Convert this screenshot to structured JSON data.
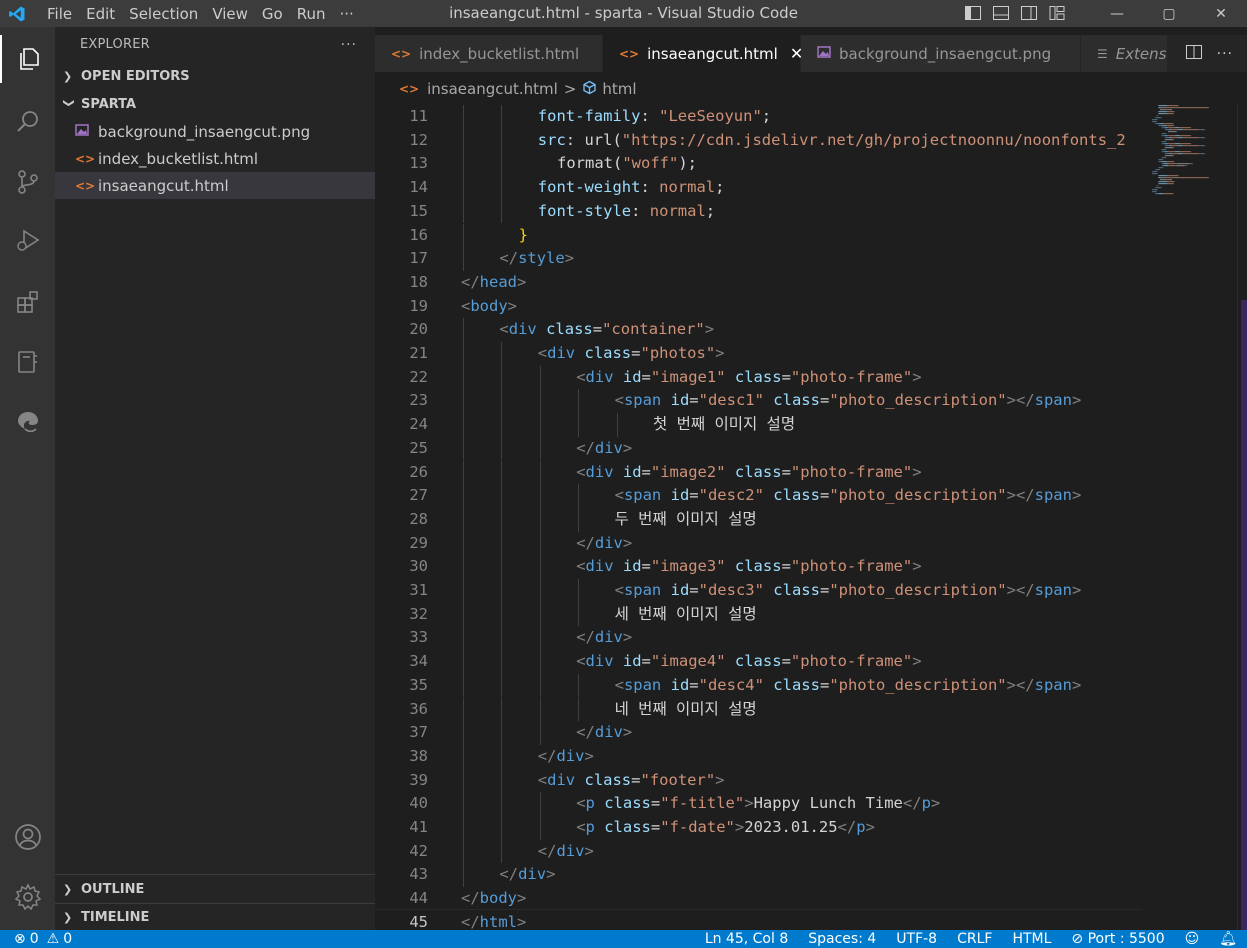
{
  "window": {
    "title": "insaeangcut.html - sparta - Visual Studio Code",
    "menu": [
      "File",
      "Edit",
      "Selection",
      "View",
      "Go",
      "Run",
      "···"
    ]
  },
  "activity_bar": {
    "items": [
      "explorer-icon",
      "search-icon",
      "source-control-icon",
      "run-debug-icon",
      "extensions-icon",
      "remote-explorer-icon",
      "edge-devtools-icon"
    ],
    "bottom": [
      "account-icon",
      "manage-gear-icon"
    ]
  },
  "sidebar": {
    "title": "EXPLORER",
    "more": "···",
    "open_editors": "OPEN EDITORS",
    "folder": "SPARTA",
    "files": [
      {
        "name": "background_insaengcut.png",
        "type": "image"
      },
      {
        "name": "index_bucketlist.html",
        "type": "html"
      },
      {
        "name": "insaeangcut.html",
        "type": "html",
        "selected": true
      }
    ],
    "outline": "OUTLINE",
    "timeline": "TIMELINE"
  },
  "tabs": [
    {
      "label": "index_bucketlist.html",
      "type": "html",
      "active": false
    },
    {
      "label": "insaeangcut.html",
      "type": "html",
      "active": true
    },
    {
      "label": "background_insaengcut.png",
      "type": "image",
      "active": false
    },
    {
      "label": "Extens",
      "type": "extension",
      "active": false
    }
  ],
  "breadcrumb": {
    "file": "insaeangcut.html",
    "separator": ">",
    "symbol": "html"
  },
  "editor": {
    "lines": [
      {
        "n": 11,
        "indent": 8,
        "tokens": [
          [
            "attr",
            "font-family"
          ],
          [
            "txt",
            ": "
          ],
          [
            "str",
            "\"LeeSeoyun\""
          ],
          [
            "txt",
            ";"
          ]
        ]
      },
      {
        "n": 12,
        "indent": 8,
        "tokens": [
          [
            "attr",
            "src"
          ],
          [
            "txt",
            ": "
          ],
          [
            "txt",
            "url("
          ],
          [
            "str",
            "\"https://cdn.jsdelivr.net/gh/projectnoonnu/noonfonts_2"
          ]
        ]
      },
      {
        "n": 13,
        "indent": 10,
        "tokens": [
          [
            "txt",
            "format("
          ],
          [
            "str",
            "\"woff\""
          ],
          [
            "txt",
            ");"
          ]
        ]
      },
      {
        "n": 14,
        "indent": 8,
        "tokens": [
          [
            "attr",
            "font-weight"
          ],
          [
            "txt",
            ": "
          ],
          [
            "str",
            "normal"
          ],
          [
            "txt",
            ";"
          ]
        ]
      },
      {
        "n": 15,
        "indent": 8,
        "tokens": [
          [
            "attr",
            "font-style"
          ],
          [
            "txt",
            ": "
          ],
          [
            "str",
            "normal"
          ],
          [
            "txt",
            ";"
          ]
        ]
      },
      {
        "n": 16,
        "indent": 6,
        "tokens": [
          [
            "brace",
            "}"
          ]
        ]
      },
      {
        "n": 17,
        "indent": 4,
        "tokens": [
          [
            "punct",
            "</"
          ],
          [
            "tag",
            "style"
          ],
          [
            "punct",
            ">"
          ]
        ]
      },
      {
        "n": 18,
        "indent": 0,
        "tokens": [
          [
            "punct",
            "</"
          ],
          [
            "tag",
            "head"
          ],
          [
            "punct",
            ">"
          ]
        ]
      },
      {
        "n": 19,
        "indent": 0,
        "tokens": [
          [
            "punct",
            "<"
          ],
          [
            "tag",
            "body"
          ],
          [
            "punct",
            ">"
          ]
        ]
      },
      {
        "n": 20,
        "indent": 4,
        "tokens": [
          [
            "punct",
            "<"
          ],
          [
            "tag",
            "div"
          ],
          [
            "txt",
            " "
          ],
          [
            "attr",
            "class"
          ],
          [
            "txt",
            "="
          ],
          [
            "str",
            "\"container\""
          ],
          [
            "punct",
            ">"
          ]
        ]
      },
      {
        "n": 21,
        "indent": 8,
        "tokens": [
          [
            "punct",
            "<"
          ],
          [
            "tag",
            "div"
          ],
          [
            "txt",
            " "
          ],
          [
            "attr",
            "class"
          ],
          [
            "txt",
            "="
          ],
          [
            "str",
            "\"photos\""
          ],
          [
            "punct",
            ">"
          ]
        ]
      },
      {
        "n": 22,
        "indent": 12,
        "tokens": [
          [
            "punct",
            "<"
          ],
          [
            "tag",
            "div"
          ],
          [
            "txt",
            " "
          ],
          [
            "attr",
            "id"
          ],
          [
            "txt",
            "="
          ],
          [
            "str",
            "\"image1\""
          ],
          [
            "txt",
            " "
          ],
          [
            "attr",
            "class"
          ],
          [
            "txt",
            "="
          ],
          [
            "str",
            "\"photo-frame\""
          ],
          [
            "punct",
            ">"
          ]
        ]
      },
      {
        "n": 23,
        "indent": 16,
        "tokens": [
          [
            "punct",
            "<"
          ],
          [
            "tag",
            "span"
          ],
          [
            "txt",
            " "
          ],
          [
            "attr",
            "id"
          ],
          [
            "txt",
            "="
          ],
          [
            "str",
            "\"desc1\""
          ],
          [
            "txt",
            " "
          ],
          [
            "attr",
            "class"
          ],
          [
            "txt",
            "="
          ],
          [
            "str",
            "\"photo_description\""
          ],
          [
            "punct",
            "></"
          ],
          [
            "tag",
            "span"
          ],
          [
            "punct",
            ">"
          ]
        ]
      },
      {
        "n": 24,
        "indent": 20,
        "tokens": [
          [
            "txt",
            "첫 번째 이미지 설명"
          ]
        ]
      },
      {
        "n": 25,
        "indent": 12,
        "tokens": [
          [
            "punct",
            "</"
          ],
          [
            "tag",
            "div"
          ],
          [
            "punct",
            ">"
          ]
        ]
      },
      {
        "n": 26,
        "indent": 12,
        "tokens": [
          [
            "punct",
            "<"
          ],
          [
            "tag",
            "div"
          ],
          [
            "txt",
            " "
          ],
          [
            "attr",
            "id"
          ],
          [
            "txt",
            "="
          ],
          [
            "str",
            "\"image2\""
          ],
          [
            "txt",
            " "
          ],
          [
            "attr",
            "class"
          ],
          [
            "txt",
            "="
          ],
          [
            "str",
            "\"photo-frame\""
          ],
          [
            "punct",
            ">"
          ]
        ]
      },
      {
        "n": 27,
        "indent": 16,
        "tokens": [
          [
            "punct",
            "<"
          ],
          [
            "tag",
            "span"
          ],
          [
            "txt",
            " "
          ],
          [
            "attr",
            "id"
          ],
          [
            "txt",
            "="
          ],
          [
            "str",
            "\"desc2\""
          ],
          [
            "txt",
            " "
          ],
          [
            "attr",
            "class"
          ],
          [
            "txt",
            "="
          ],
          [
            "str",
            "\"photo_description\""
          ],
          [
            "punct",
            "></"
          ],
          [
            "tag",
            "span"
          ],
          [
            "punct",
            ">"
          ]
        ]
      },
      {
        "n": 28,
        "indent": 16,
        "tokens": [
          [
            "txt",
            "두 번째 이미지 설명"
          ]
        ]
      },
      {
        "n": 29,
        "indent": 12,
        "tokens": [
          [
            "punct",
            "</"
          ],
          [
            "tag",
            "div"
          ],
          [
            "punct",
            ">"
          ]
        ]
      },
      {
        "n": 30,
        "indent": 12,
        "tokens": [
          [
            "punct",
            "<"
          ],
          [
            "tag",
            "div"
          ],
          [
            "txt",
            " "
          ],
          [
            "attr",
            "id"
          ],
          [
            "txt",
            "="
          ],
          [
            "str",
            "\"image3\""
          ],
          [
            "txt",
            " "
          ],
          [
            "attr",
            "class"
          ],
          [
            "txt",
            "="
          ],
          [
            "str",
            "\"photo-frame\""
          ],
          [
            "punct",
            ">"
          ]
        ]
      },
      {
        "n": 31,
        "indent": 16,
        "tokens": [
          [
            "punct",
            "<"
          ],
          [
            "tag",
            "span"
          ],
          [
            "txt",
            " "
          ],
          [
            "attr",
            "id"
          ],
          [
            "txt",
            "="
          ],
          [
            "str",
            "\"desc3\""
          ],
          [
            "txt",
            " "
          ],
          [
            "attr",
            "class"
          ],
          [
            "txt",
            "="
          ],
          [
            "str",
            "\"photo_description\""
          ],
          [
            "punct",
            "></"
          ],
          [
            "tag",
            "span"
          ],
          [
            "punct",
            ">"
          ]
        ]
      },
      {
        "n": 32,
        "indent": 16,
        "tokens": [
          [
            "txt",
            "세 번째 이미지 설명"
          ]
        ]
      },
      {
        "n": 33,
        "indent": 12,
        "tokens": [
          [
            "punct",
            "</"
          ],
          [
            "tag",
            "div"
          ],
          [
            "punct",
            ">"
          ]
        ]
      },
      {
        "n": 34,
        "indent": 12,
        "tokens": [
          [
            "punct",
            "<"
          ],
          [
            "tag",
            "div"
          ],
          [
            "txt",
            " "
          ],
          [
            "attr",
            "id"
          ],
          [
            "txt",
            "="
          ],
          [
            "str",
            "\"image4\""
          ],
          [
            "txt",
            " "
          ],
          [
            "attr",
            "class"
          ],
          [
            "txt",
            "="
          ],
          [
            "str",
            "\"photo-frame\""
          ],
          [
            "punct",
            ">"
          ]
        ]
      },
      {
        "n": 35,
        "indent": 16,
        "tokens": [
          [
            "punct",
            "<"
          ],
          [
            "tag",
            "span"
          ],
          [
            "txt",
            " "
          ],
          [
            "attr",
            "id"
          ],
          [
            "txt",
            "="
          ],
          [
            "str",
            "\"desc4\""
          ],
          [
            "txt",
            " "
          ],
          [
            "attr",
            "class"
          ],
          [
            "txt",
            "="
          ],
          [
            "str",
            "\"photo_description\""
          ],
          [
            "punct",
            "></"
          ],
          [
            "tag",
            "span"
          ],
          [
            "punct",
            ">"
          ]
        ]
      },
      {
        "n": 36,
        "indent": 16,
        "tokens": [
          [
            "txt",
            "네 번째 이미지 설명"
          ]
        ]
      },
      {
        "n": 37,
        "indent": 12,
        "tokens": [
          [
            "punct",
            "</"
          ],
          [
            "tag",
            "div"
          ],
          [
            "punct",
            ">"
          ]
        ]
      },
      {
        "n": 38,
        "indent": 8,
        "tokens": [
          [
            "punct",
            "</"
          ],
          [
            "tag",
            "div"
          ],
          [
            "punct",
            ">"
          ]
        ]
      },
      {
        "n": 39,
        "indent": 8,
        "tokens": [
          [
            "punct",
            "<"
          ],
          [
            "tag",
            "div"
          ],
          [
            "txt",
            " "
          ],
          [
            "attr",
            "class"
          ],
          [
            "txt",
            "="
          ],
          [
            "str",
            "\"footer\""
          ],
          [
            "punct",
            ">"
          ]
        ]
      },
      {
        "n": 40,
        "indent": 12,
        "tokens": [
          [
            "punct",
            "<"
          ],
          [
            "tag",
            "p"
          ],
          [
            "txt",
            " "
          ],
          [
            "attr",
            "class"
          ],
          [
            "txt",
            "="
          ],
          [
            "str",
            "\"f-title\""
          ],
          [
            "punct",
            ">"
          ],
          [
            "txt",
            "Happy Lunch Time"
          ],
          [
            "punct",
            "</"
          ],
          [
            "tag",
            "p"
          ],
          [
            "punct",
            ">"
          ]
        ]
      },
      {
        "n": 41,
        "indent": 12,
        "tokens": [
          [
            "punct",
            "<"
          ],
          [
            "tag",
            "p"
          ],
          [
            "txt",
            " "
          ],
          [
            "attr",
            "class"
          ],
          [
            "txt",
            "="
          ],
          [
            "str",
            "\"f-date\""
          ],
          [
            "punct",
            ">"
          ],
          [
            "txt",
            "2023.01.25"
          ],
          [
            "punct",
            "</"
          ],
          [
            "tag",
            "p"
          ],
          [
            "punct",
            ">"
          ]
        ]
      },
      {
        "n": 42,
        "indent": 8,
        "tokens": [
          [
            "punct",
            "</"
          ],
          [
            "tag",
            "div"
          ],
          [
            "punct",
            ">"
          ]
        ]
      },
      {
        "n": 43,
        "indent": 4,
        "tokens": [
          [
            "punct",
            "</"
          ],
          [
            "tag",
            "div"
          ],
          [
            "punct",
            ">"
          ]
        ]
      },
      {
        "n": 44,
        "indent": 0,
        "tokens": [
          [
            "punct",
            "</"
          ],
          [
            "tag",
            "body"
          ],
          [
            "punct",
            ">"
          ]
        ]
      },
      {
        "n": 45,
        "indent": 0,
        "tokens": [
          [
            "punct",
            "</"
          ],
          [
            "tag",
            "html"
          ],
          [
            "punct",
            ">"
          ]
        ]
      }
    ],
    "current_line": 45
  },
  "statusbar": {
    "errors": "0",
    "warnings": "0",
    "position": "Ln 45, Col 8",
    "spaces": "Spaces: 4",
    "encoding": "UTF-8",
    "eol": "CRLF",
    "language": "HTML",
    "port": "Port : 5500"
  },
  "colors": {
    "accent": "#007acc",
    "tag": "#569cd6",
    "attr": "#9cdcfe",
    "string": "#ce9178",
    "brace": "#ffd700",
    "html_icon": "#e37933",
    "image_icon": "#a074c4"
  }
}
